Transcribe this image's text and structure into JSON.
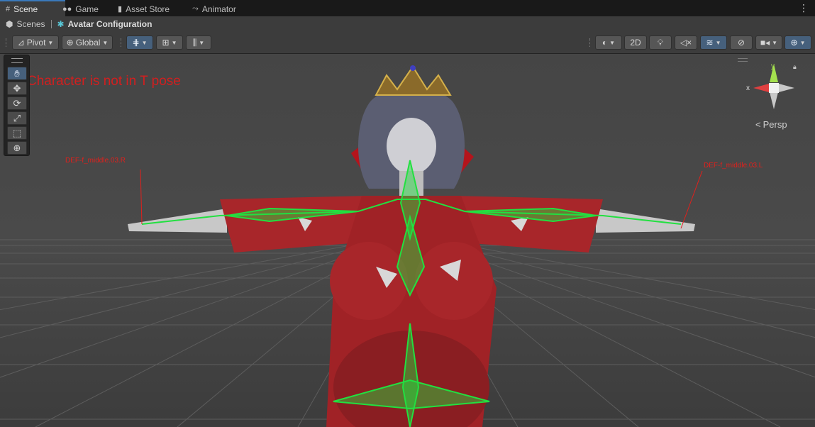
{
  "tabs": [
    {
      "label": "Scene",
      "icon": "grid-icon",
      "active": true
    },
    {
      "label": "Game",
      "icon": "gamepad-icon",
      "active": false
    },
    {
      "label": "Asset Store",
      "icon": "store-bag-icon",
      "active": false
    },
    {
      "label": "Animator",
      "icon": "animator-graph-icon",
      "active": false
    }
  ],
  "breadcrumb": {
    "root": "Scenes",
    "current": "Avatar Configuration"
  },
  "toolbar": {
    "pivot_label": "Pivot",
    "global_label": "Global",
    "two_d_label": "2D"
  },
  "viewport": {
    "warning": "Character is not in T pose",
    "bone_label_right": "DEF-f_middle.03.R",
    "bone_label_left": "DEF-f_middle.03.L",
    "persp_label": "Persp",
    "axis_x": "x",
    "axis_y": "y"
  },
  "colors": {
    "accent": "#3a79bb",
    "warning_red": "#d21f1f",
    "bone_green": "#22e040",
    "dress_red": "#a8262a"
  }
}
